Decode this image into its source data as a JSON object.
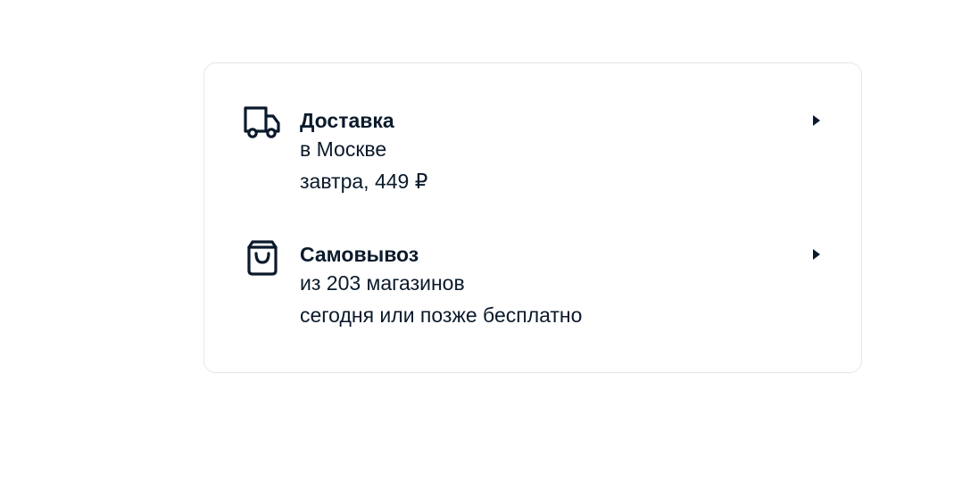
{
  "delivery_options": [
    {
      "icon": "truck-icon",
      "title": "Доставка",
      "line1": "в Москве",
      "line2": "завтра, 449 ₽"
    },
    {
      "icon": "shopping-bag-icon",
      "title": "Самовывоз",
      "line1": "из 203 магазинов",
      "line2": "сегодня или позже бесплатно"
    }
  ],
  "colors": {
    "text": "#0b1a2b",
    "card_border": "#e4e6ea",
    "background": "#ffffff"
  }
}
